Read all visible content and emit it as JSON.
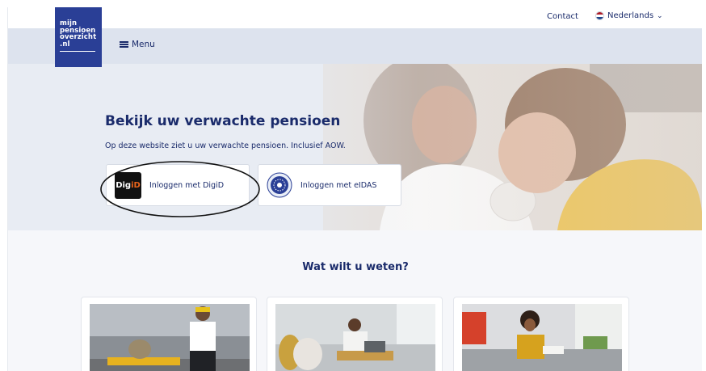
{
  "header": {
    "contact_label": "Contact",
    "language_label": "Nederlands"
  },
  "logo": {
    "lines": [
      "mijn",
      "pensioen",
      "overzicht",
      ".nl"
    ]
  },
  "menu": {
    "label": "Menu"
  },
  "hero": {
    "title": "Bekijk uw verwachte pensioen",
    "subtitle": "Op deze website ziet u uw verwachte pensioen. Inclusief AOW.",
    "buttons": [
      {
        "label": "Inloggen met DigiD",
        "logo_text_a": "Dig",
        "logo_text_b": "iD",
        "icon": "digid-logo-icon"
      },
      {
        "label": "Inloggen met eIDAS",
        "icon": "eidas-logo-icon"
      }
    ]
  },
  "section": {
    "title": "Wat wilt u weten?",
    "cards": [
      {
        "icon": "photo-man-headphones"
      },
      {
        "icon": "photo-woman-laptop"
      },
      {
        "icon": "photo-woman-reading"
      }
    ]
  },
  "colors": {
    "brand_navy": "#1a2b6b",
    "logo_blue": "#2a3f96",
    "menu_bg": "#dde3ee",
    "hero_bg": "#e8ecf3",
    "annotation": "#111111"
  }
}
